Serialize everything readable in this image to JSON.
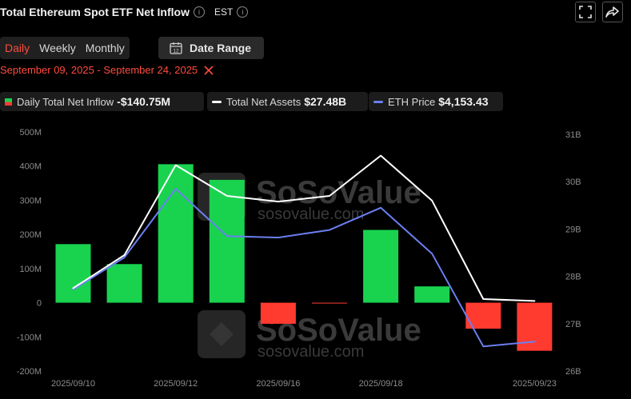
{
  "header": {
    "title": "Total Ethereum Spot ETF Net Inflow",
    "info_glyph": "i",
    "timezone": "EST",
    "icons": [
      "fullscreen-icon",
      "share-icon"
    ]
  },
  "tabs": [
    {
      "label": "Daily",
      "active": true
    },
    {
      "label": "Weekly",
      "active": false
    },
    {
      "label": "Monthly",
      "active": false
    }
  ],
  "date_range_button": {
    "label": "Date Range",
    "icon": "calendar-icon",
    "icon_text": "12"
  },
  "selected_range": {
    "text": "September 09, 2025 - September 24, 2025",
    "close_icon": "close-icon"
  },
  "legend": [
    {
      "name": "Daily Total Net Inflow",
      "value": "-$140.75M"
    },
    {
      "name": "Total Net Assets",
      "value": "$27.48B",
      "color": "#ffffff"
    },
    {
      "name": "ETH Price",
      "value": "$4,153.43",
      "color": "#6b7ff0"
    }
  ],
  "watermark": {
    "brand": "SoSoValue",
    "url": "sosovalue.com"
  },
  "colors": {
    "positive": "#19d34f",
    "negative": "#ff3b30",
    "accent": "#ff4b3e"
  },
  "chart_data": {
    "type": "bar",
    "x": [
      "2025/09/10",
      "2025/09/11",
      "2025/09/12",
      "2025/09/15",
      "2025/09/16",
      "2025/09/17",
      "2025/09/18",
      "2025/09/19",
      "2025/09/22",
      "2025/09/23"
    ],
    "x_tick_labels": [
      "2025/09/10",
      "2025/09/12",
      "2025/09/16",
      "2025/09/18",
      "2025/09/23"
    ],
    "series": [
      {
        "name": "Daily Total Net Inflow",
        "type": "bar",
        "axis": "left",
        "values": [
          171.5,
          113.1,
          405.5,
          359.7,
          -61.7,
          -1.9,
          213.1,
          47.8,
          -76.0,
          -140.75
        ]
      },
      {
        "name": "Total Net Assets",
        "type": "line",
        "axis": "right",
        "values": [
          27.75,
          28.45,
          30.35,
          29.7,
          29.58,
          29.7,
          30.55,
          29.6,
          27.52,
          27.48
        ]
      },
      {
        "name": "ETH Price",
        "type": "line",
        "axis": "right",
        "values": [
          27.72,
          28.4,
          29.85,
          28.85,
          28.82,
          28.98,
          29.45,
          28.48,
          26.52,
          26.62
        ]
      }
    ],
    "y_left": {
      "ylim": [
        -200,
        500
      ],
      "ticks": [
        500,
        400,
        300,
        200,
        100,
        0,
        -100,
        -200
      ],
      "tick_labels": [
        "500M",
        "400M",
        "300M",
        "200M",
        "100M",
        "0",
        "-100M",
        "-200M"
      ]
    },
    "y_right": {
      "ylim": [
        26,
        31
      ],
      "ticks": [
        31,
        30,
        29,
        28,
        27,
        26
      ],
      "tick_labels": [
        "31B",
        "30B",
        "29B",
        "28B",
        "27B",
        "26B"
      ]
    },
    "grid": false
  }
}
